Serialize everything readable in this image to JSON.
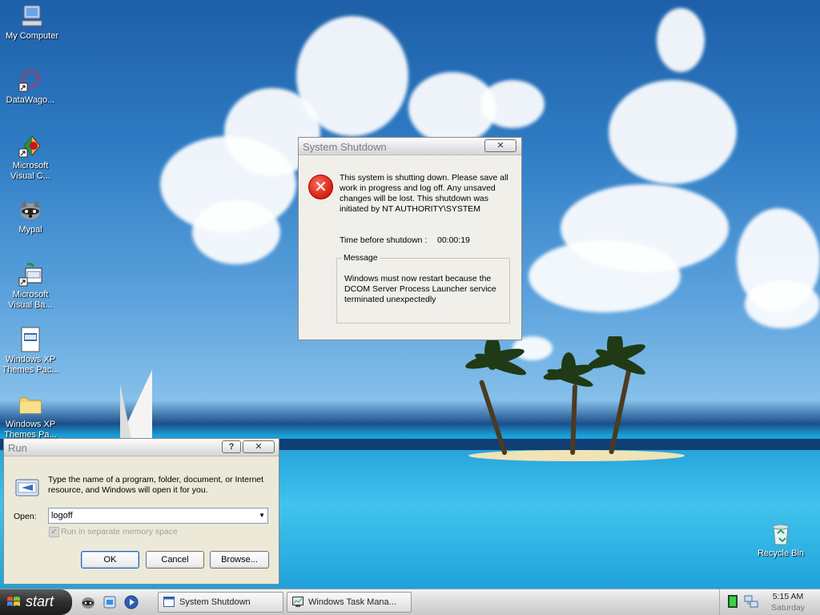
{
  "desktop": {
    "icons": [
      {
        "label": "My Computer",
        "icon": "my-computer-icon"
      },
      {
        "label": "DataWago...",
        "icon": "datawagon-shortcut-icon"
      },
      {
        "label": "Microsoft Visual C...",
        "icon": "visual-c-shortcut-icon"
      },
      {
        "label": "Mypal",
        "icon": "mypal-browser-icon"
      },
      {
        "label": "Microsoft Visual Ba...",
        "icon": "visual-basic-shortcut-icon"
      },
      {
        "label": "Windows XP Themes Pac...",
        "icon": "themes-pack-icon"
      },
      {
        "label": "Windows XP Themes Pa...",
        "icon": "folder-icon"
      },
      {
        "label": "Recycle Bin",
        "icon": "recycle-bin-icon"
      }
    ]
  },
  "shutdown_dialog": {
    "title": "System Shutdown",
    "close_label": "✕",
    "message": "This system is shutting down. Please save all work in progress and log off. Any unsaved changes will be lost. This shutdown was initiated by NT AUTHORITY\\SYSTEM",
    "time_label": "Time before shutdown :",
    "time_value": "00:00:19",
    "group_label": "Message",
    "group_text": "Windows must now restart because the DCOM Server Process Launcher service terminated unexpectedly"
  },
  "run_dialog": {
    "title": "Run",
    "help_label": "?",
    "close_label": "✕",
    "description": "Type the name of a program, folder, document, or Internet resource, and Windows will open it for you.",
    "open_label": "Open:",
    "open_value": "logoff",
    "checkbox_label": "Run in separate memory space",
    "checkbox_checked": true,
    "ok_label": "OK",
    "cancel_label": "Cancel",
    "browse_label": "Browse..."
  },
  "taskbar": {
    "start_label": "start",
    "quick_launch": [
      "raccoon-browser-icon",
      "windows-explorer-icon",
      "media-player-icon"
    ],
    "items": [
      {
        "label": "System Shutdown"
      },
      {
        "label": "Windows Task Mana..."
      }
    ],
    "clock_time": "5:15 AM",
    "clock_day": "Saturday"
  }
}
